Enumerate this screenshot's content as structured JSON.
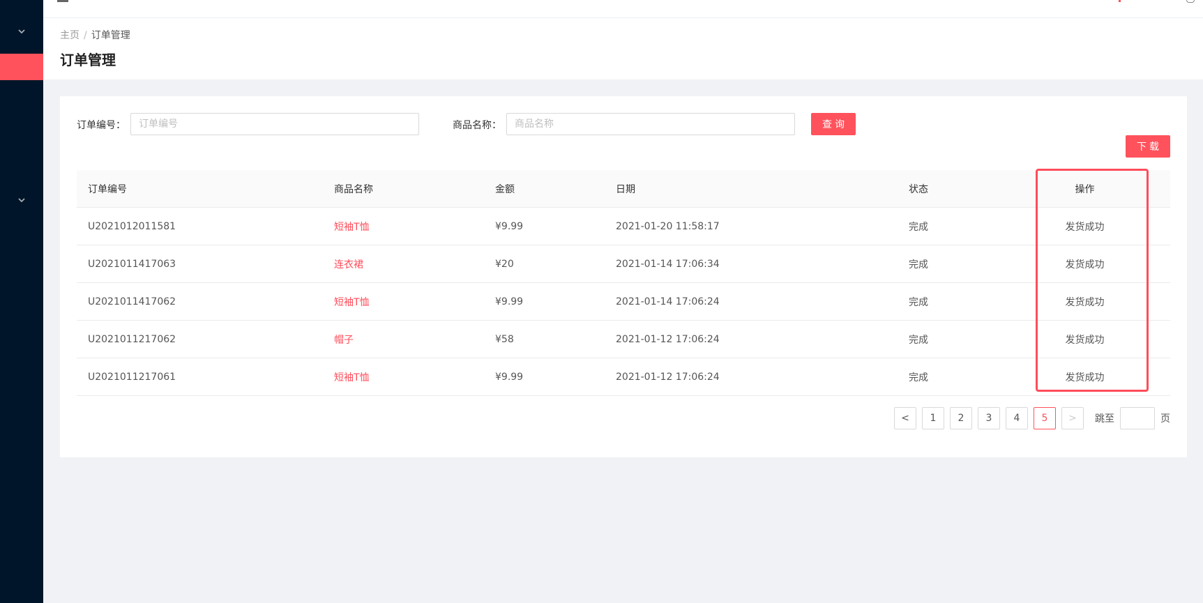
{
  "sidebar": {
    "icons": [
      "chevron-down-icon",
      "chevron-down-icon"
    ],
    "active_color": "#ff525c",
    "background": "#001529"
  },
  "breadcrumb": {
    "home": "主页",
    "separator": "/",
    "current": "订单管理"
  },
  "page_title": "订单管理",
  "search": {
    "order_label": "订单编号：",
    "order_placeholder": "订单编号",
    "order_value": "",
    "product_label": "商品名称：",
    "product_placeholder": "商品名称",
    "product_value": "",
    "query_label": "查询",
    "download_label": "下载"
  },
  "table": {
    "columns": [
      "订单编号",
      "商品名称",
      "金额",
      "日期",
      "状态",
      "操作"
    ],
    "rows": [
      {
        "order_id": "U2021012011581",
        "product": "短袖T恤",
        "amount": "¥9.99",
        "date": "2021-01-20 11:58:17",
        "status": "完成",
        "action": "发货成功"
      },
      {
        "order_id": "U2021011417063",
        "product": "连衣裙",
        "amount": "¥20",
        "date": "2021-01-14 17:06:34",
        "status": "完成",
        "action": "发货成功"
      },
      {
        "order_id": "U2021011417062",
        "product": "短袖T恤",
        "amount": "¥9.99",
        "date": "2021-01-14 17:06:24",
        "status": "完成",
        "action": "发货成功"
      },
      {
        "order_id": "U2021011217062",
        "product": "帽子",
        "amount": "¥58",
        "date": "2021-01-12 17:06:24",
        "status": "完成",
        "action": "发货成功"
      },
      {
        "order_id": "U2021011217061",
        "product": "短袖T恤",
        "amount": "¥9.99",
        "date": "2021-01-12 17:06:24",
        "status": "完成",
        "action": "发货成功"
      }
    ]
  },
  "pagination": {
    "prev": "<",
    "pages": [
      "1",
      "2",
      "3",
      "4",
      "5"
    ],
    "current": "5",
    "next": ">",
    "jump_label": "跳至",
    "jump_value": "",
    "jump_suffix": "页"
  },
  "colors": {
    "accent": "#ff525c",
    "product_text": "#ff4d5a",
    "highlight_box": "#ff4d5a"
  }
}
